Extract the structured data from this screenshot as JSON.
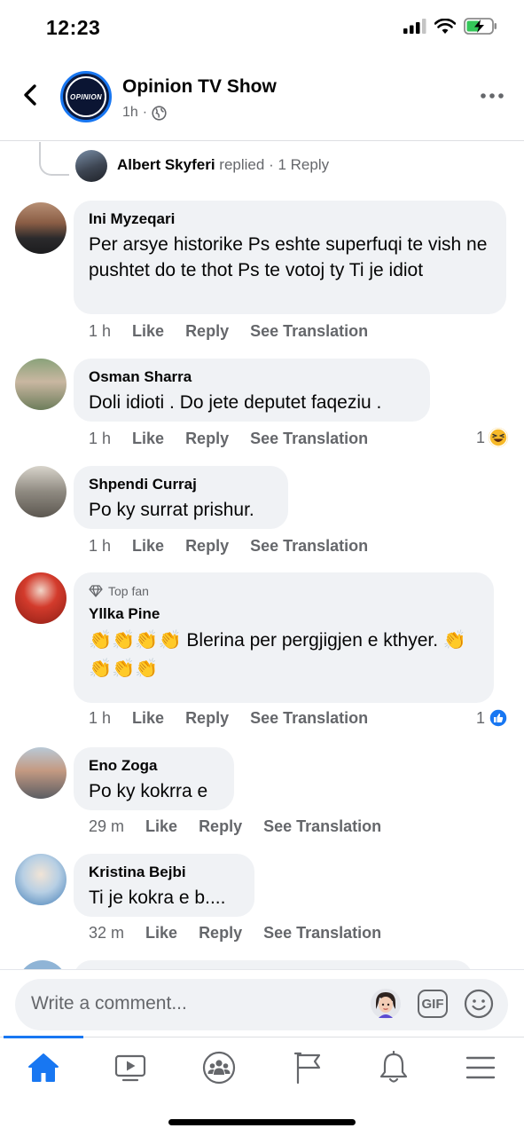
{
  "status_bar": {
    "time": "12:23"
  },
  "header": {
    "back_icon": "chevron-left-icon",
    "page_name": "Opinion TV Show",
    "logo_text": "OPINION",
    "time_ago": "1h",
    "audience_icon": "globe-icon",
    "more_icon": "more-horizontal-icon"
  },
  "reply_summary": {
    "name": "Albert Skyferi",
    "verb": "replied",
    "count": "1 Reply"
  },
  "comments": [
    {
      "name": "Ini Myzeqari",
      "text": "Per arsye historike Ps eshte superfuqi te vish ne pushtet do te thot Ps te votoj ty Ti je idiot",
      "time": "1 h",
      "like": "Like",
      "reply": "Reply",
      "translate": "See Translation"
    },
    {
      "name": "Osman Sharra",
      "text": "Doli idioti . Do jete deputet faqeziu .",
      "time": "1 h",
      "like": "Like",
      "reply": "Reply",
      "translate": "See Translation",
      "reaction_count": "1",
      "reaction_icon": "haha-laughing-emoji-icon"
    },
    {
      "name": "Shpendi Curraj",
      "text": "Po ky surrat prishur.",
      "time": "1 h",
      "like": "Like",
      "reply": "Reply",
      "translate": "See Translation"
    },
    {
      "badge": "Top fan",
      "badge_icon": "diamond-icon",
      "name": "Yllka Pine",
      "text": "👏👏👏👏 Blerina per pergjigjen e kthyer. 👏👏👏👏",
      "time": "1 h",
      "like": "Like",
      "reply": "Reply",
      "translate": "See Translation",
      "reaction_count": "1",
      "reaction_icon": "like-thumbs-up-icon"
    },
    {
      "name": "Eno Zoga",
      "text": "Po ky kokrra e",
      "time": "29 m",
      "like": "Like",
      "reply": "Reply",
      "translate": "See Translation"
    },
    {
      "name": "Kristina Bejbi",
      "text": "Ti je kokra e b....",
      "time": "32 m",
      "like": "Like",
      "reply": "Reply",
      "translate": "See Translation"
    }
  ],
  "composer": {
    "placeholder": "Write a comment...",
    "gif_label": "GIF",
    "avatar_icon": "avatar-sticker-icon",
    "emoji_icon": "smiley-icon"
  },
  "bottom_nav": {
    "items": [
      "home-icon",
      "video-icon",
      "groups-icon",
      "pages-flag-icon",
      "notifications-bell-icon",
      "menu-icon"
    ],
    "active": "home-icon"
  },
  "colors": {
    "accent": "#1877f2",
    "bubble": "#f0f2f5",
    "secondary_text": "#65676b",
    "haha": "#f7b928"
  }
}
